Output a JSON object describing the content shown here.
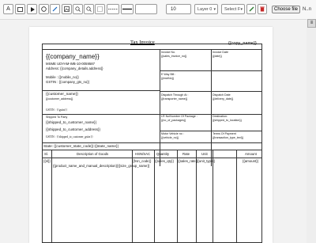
{
  "toolbar": {
    "text_tool": "A",
    "line_width": "",
    "font_size": "10",
    "layer_select": "Layer 0",
    "select_field": "Select F",
    "choose_file": "Choose file",
    "file_name": "N..n"
  },
  "invoice": {
    "title": "Tax Invoice",
    "copy_name": "{{copy_name}}",
    "company_name": "{{company_name}}",
    "msme": "MSME UDYAM-WB-10-0059587",
    "address": "Address: {{company_details.address}}",
    "mobile": "Mobile : {{mobile_no}}",
    "gstin": "GSTIN : {{company_gts_no}}",
    "invoice_no_label": "Invoice No.",
    "invoice_no": "{{sales_invoice_no}}",
    "invoice_date_label": "Invoice Date",
    "invoice_date": "{{date}}",
    "eway_label": "E Way Bill :",
    "eway": "{{ewbNo}}",
    "customer_name": "{{customer_name}}",
    "customer_address": "{{customer_address}}",
    "customer_gstin": "GSTIN : {{gstin}}",
    "dispatch_through_label": "Dispatch Through At :",
    "dispatch_through": "{{transporter_name}}",
    "dispatch_date_label": "Dispatch Date",
    "dispatch_date": "{{delivery_date}}",
    "shipped_label": "Shipped To Party",
    "shipped_name": "{{shipped_to_customer_name}}",
    "shipped_address": "{{shipped_to_customer_address}}",
    "shipped_gstin": "GSTIN : {{shipped_to_customer_gstin}}",
    "lr_label": "LR No/Number Of Package :",
    "lr": "{{no_of_packages}}",
    "destination_label": "Destination:",
    "destination": "{{shipped_to_location}}",
    "motor_label": "Motor Vehicle no :",
    "motor": "{{vehicle_no}}",
    "terms_label": "Terms Of Payment",
    "terms": "{{transaction_type_text}}",
    "state": "State: {{customer_state_code}}-{{state_name}}",
    "col_sl": "Sl.",
    "col_desc": "Description of Goods",
    "col_hsn": "HSN/SAC",
    "col_qty": "Quantity",
    "col_rate": "Rate",
    "col_unit": "Unit",
    "col_amount": "Amount",
    "row_sl": "{{sl}}",
    "row_desc": "{{product_name_and_manual_description}}{{size_group_name}}",
    "row_hsn": "{{hsn_code}}",
    "row_qty": "{{sales_qty}}",
    "row_rate": "{{sales_rate}}",
    "row_unit": "{{unit_type}}",
    "row_amount": "{{amount}}"
  }
}
